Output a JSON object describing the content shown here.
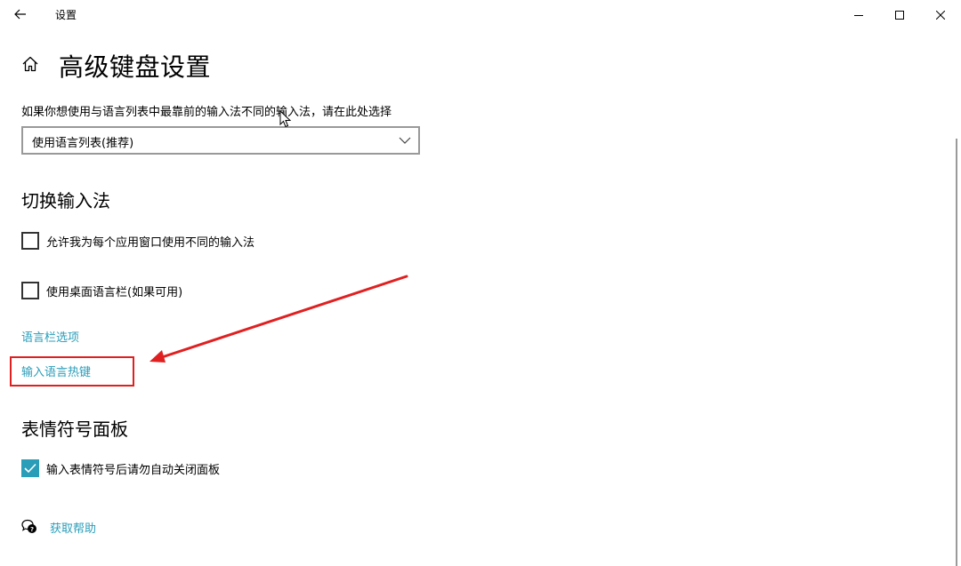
{
  "window": {
    "title": "设置",
    "icons": {
      "back": "back-arrow-icon",
      "minimize": "minimize-icon",
      "maximize": "maximize-icon",
      "close": "close-icon"
    }
  },
  "header": {
    "home_icon": "home-icon",
    "title": "高级键盘设置"
  },
  "input_method_override": {
    "description": "如果你想使用与语言列表中最靠前的输入法不同的输入法，请在此处选择",
    "selected_value": "使用语言列表(推荐)"
  },
  "switch_input_methods": {
    "title": "切换输入法",
    "checkbox_per_app": {
      "label": "允许我为每个应用窗口使用不同的输入法",
      "checked": false
    },
    "checkbox_language_bar": {
      "label": "使用桌面语言栏(如果可用)",
      "checked": false
    },
    "link_language_bar_options": "语言栏选项",
    "link_input_language_hotkeys": "输入语言热键"
  },
  "emoji_panel": {
    "title": "表情符号面板",
    "checkbox_close_panel": {
      "label": "输入表情符号后请勿自动关闭面板",
      "checked": true
    }
  },
  "help": {
    "icon": "help-chat-icon",
    "link": "获取帮助"
  },
  "colors": {
    "accent": "#2a9db9",
    "annotation_red": "#e02020"
  }
}
